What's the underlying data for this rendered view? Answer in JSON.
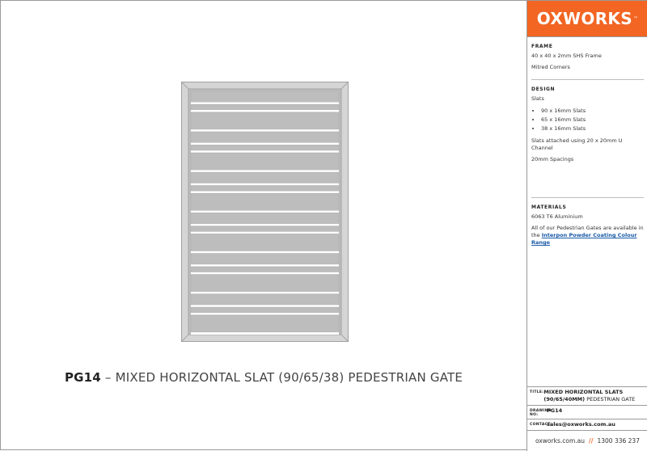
{
  "drawing": {
    "code": "PG14",
    "title_rest": " – MIXED HORIZONTAL SLAT (90/65/38) PEDESTRIAN GATE",
    "colors": {
      "frame": "#d5d5d5",
      "slat": "#bdbdbd",
      "gap": "#ffffff"
    }
  },
  "panel": {
    "logo": "OXWORKS",
    "logo_mark": "™",
    "frame": {
      "heading": "FRAME",
      "lines": [
        "40 x 40 x 2mm SHS Frame",
        "Mitred Corners"
      ]
    },
    "design": {
      "heading": "DESIGN",
      "intro": "Slats",
      "bullets": [
        "90 x 16mm Slats",
        "65 x 16mm Slats",
        "38 x 16mm Slats"
      ],
      "attached": "Slats attached using 20 x 20mm U Channel",
      "spacing": "20mm Spacings"
    },
    "materials": {
      "heading": "MATERIALS",
      "alloy": "6063 T6 Aluminium",
      "note_before": "All of our Pedestrian Gates are available in the ",
      "note_link": "Interpon Powder Coating Colour Range"
    }
  },
  "title_block": {
    "title_label": "TITLE:",
    "title_bold": "MIXED HORIZONTAL SLATS (90/65/40MM)",
    "title_rest": " PEDESTRIAN GATE",
    "drawing_label": "DRAWING NO:",
    "drawing_no": "PG14",
    "contact_label": "CONTACT:",
    "contact_email": "sales@oxworks.com.au"
  },
  "footer": {
    "website": "oxworks.com.au",
    "separator": "//",
    "phone": "1300 336 237"
  },
  "brand_color": "#f26522"
}
